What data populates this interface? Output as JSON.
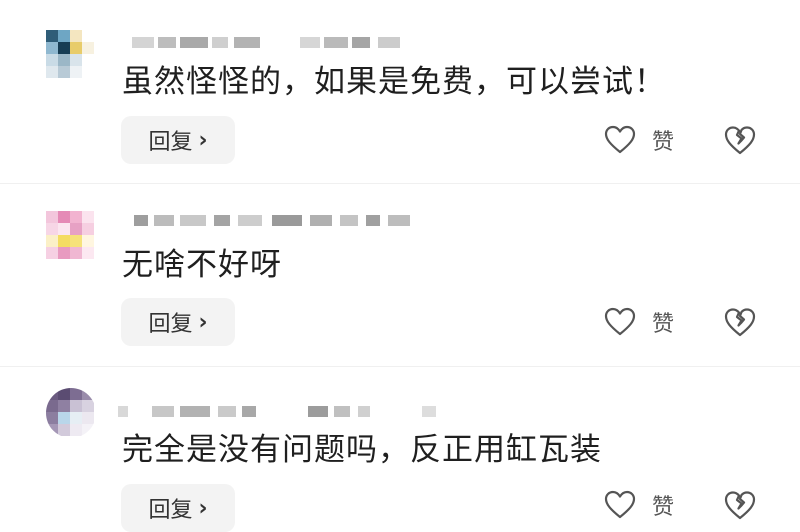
{
  "comments": [
    {
      "text": "虽然怪怪的，如果是免费，可以尝试！",
      "reply_label": "回复",
      "like_label": "赞"
    },
    {
      "text": "无啥不好呀",
      "reply_label": "回复",
      "like_label": "赞"
    },
    {
      "text": "完全是没有问题吗，反正用缸瓦装",
      "reply_label": "回复",
      "like_label": "赞"
    }
  ],
  "icons": {
    "like": "heart-outline-icon",
    "dislike": "broken-heart-icon",
    "reply_chevron": "chevron-right-icon"
  },
  "colors": {
    "reply_bg": "#f3f3f3",
    "text": "#1f1f1f",
    "icon": "#555555"
  }
}
